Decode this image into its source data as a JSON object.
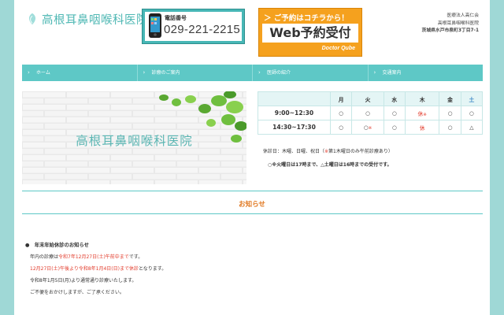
{
  "header": {
    "clinic_name": "高根耳鼻咽喉科医院",
    "phone_label": "電話番号",
    "phone_number": "029-221-2215",
    "web_reserve_top": "＞ ご予約はコチラから！",
    "web_reserve_main": "Web予約受付",
    "web_reserve_sub": "Doctor Qube",
    "info_line1": "医療法人高仁会",
    "info_line2": "高根耳鼻咽喉科医院",
    "info_address": "茨城県水戸市泉町3丁目7-1"
  },
  "nav": {
    "items": [
      {
        "label": "ホーム"
      },
      {
        "label": "診療のご案内"
      },
      {
        "label": "医師の紹介"
      },
      {
        "label": "交通案内"
      }
    ]
  },
  "hero": {
    "text": "高根耳鼻咽喉科医院"
  },
  "hours": {
    "days": [
      "月",
      "火",
      "水",
      "木",
      "金",
      "土"
    ],
    "rows": [
      {
        "time": "9:00~12:30",
        "cells": [
          "○",
          "○",
          "○",
          "休",
          "○",
          "○"
        ]
      },
      {
        "time": "14:30~17:30",
        "cells": [
          "○",
          "○",
          "○",
          "休",
          "○",
          "△"
        ]
      }
    ],
    "row1_thu_note": "※",
    "row2_tue_note": "※",
    "closed_note_prefix": "休診日：木曜、日曜、祝日（",
    "closed_note_mark": "※",
    "closed_note_suffix": "第1木曜日のみ午前診療あり）",
    "hours_note": "○※火曜日は17時まで、△土曜日は16時までの受付です。",
    "colors": {
      "saturday": "#3e88c7",
      "sunday": "#e65a5a",
      "closed": "#e23b2b"
    }
  },
  "news": {
    "heading": "お知らせ",
    "item_title": "●　年末年始休診のお知らせ",
    "line1_prefix": "年内の診療は",
    "line1_highlight": "令和7年12月27日(土)午前中まで",
    "line1_suffix": "です。",
    "line2_highlight": "12月27日(土)午後より令和8年1月4日(日)まで休診",
    "line2_suffix": "となります。",
    "line3": "令和8年1月5日(月)より通常通り診療いたします。",
    "line4": "ご不便をおかけしますが、ご了承ください。"
  },
  "colors": {
    "teal": "#5ec8c6",
    "orange": "#f5a11e",
    "background": "#9fd8d6"
  }
}
